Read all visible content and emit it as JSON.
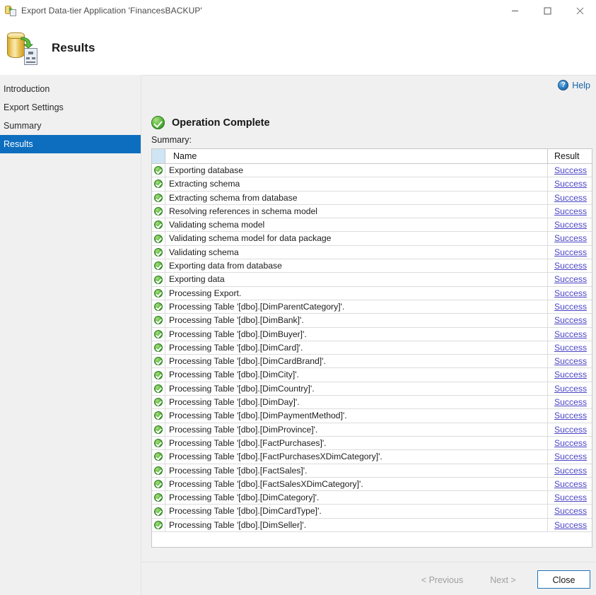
{
  "window": {
    "title": "Export Data-tier Application 'FinancesBACKUP'",
    "app_icon": "database-export-icon",
    "controls": {
      "minimize": "minimize-icon",
      "maximize": "maximize-icon",
      "close": "close-icon"
    }
  },
  "header": {
    "title": "Results",
    "icon": "database-to-document-icon"
  },
  "sidebar": {
    "items": [
      {
        "label": "Introduction",
        "active": false
      },
      {
        "label": "Export Settings",
        "active": false
      },
      {
        "label": "Summary",
        "active": false
      },
      {
        "label": "Results",
        "active": true
      }
    ]
  },
  "content": {
    "help_label": "Help",
    "help_icon": "help-circle-icon",
    "status_title": "Operation Complete",
    "status_icon": "success-check-icon",
    "summary_label": "Summary:"
  },
  "table": {
    "columns": {
      "icon": "",
      "name": "Name",
      "result": "Result"
    },
    "rows": [
      {
        "name": "Exporting database",
        "result": "Success"
      },
      {
        "name": "Extracting schema",
        "result": "Success"
      },
      {
        "name": "Extracting schema from database",
        "result": "Success"
      },
      {
        "name": "Resolving references in schema model",
        "result": "Success"
      },
      {
        "name": "Validating schema model",
        "result": "Success"
      },
      {
        "name": "Validating schema model for data package",
        "result": "Success"
      },
      {
        "name": "Validating schema",
        "result": "Success"
      },
      {
        "name": "Exporting data from database",
        "result": "Success"
      },
      {
        "name": "Exporting data",
        "result": "Success"
      },
      {
        "name": "Processing Export.",
        "result": "Success"
      },
      {
        "name": "Processing Table '[dbo].[DimParentCategory]'.",
        "result": "Success"
      },
      {
        "name": "Processing Table '[dbo].[DimBank]'.",
        "result": "Success"
      },
      {
        "name": "Processing Table '[dbo].[DimBuyer]'.",
        "result": "Success"
      },
      {
        "name": "Processing Table '[dbo].[DimCard]'.",
        "result": "Success"
      },
      {
        "name": "Processing Table '[dbo].[DimCardBrand]'.",
        "result": "Success"
      },
      {
        "name": "Processing Table '[dbo].[DimCity]'.",
        "result": "Success"
      },
      {
        "name": "Processing Table '[dbo].[DimCountry]'.",
        "result": "Success"
      },
      {
        "name": "Processing Table '[dbo].[DimDay]'.",
        "result": "Success"
      },
      {
        "name": "Processing Table '[dbo].[DimPaymentMethod]'.",
        "result": "Success"
      },
      {
        "name": "Processing Table '[dbo].[DimProvince]'.",
        "result": "Success"
      },
      {
        "name": "Processing Table '[dbo].[FactPurchases]'.",
        "result": "Success"
      },
      {
        "name": "Processing Table '[dbo].[FactPurchasesXDimCategory]'.",
        "result": "Success"
      },
      {
        "name": "Processing Table '[dbo].[FactSales]'.",
        "result": "Success"
      },
      {
        "name": "Processing Table '[dbo].[FactSalesXDimCategory]'.",
        "result": "Success"
      },
      {
        "name": "Processing Table '[dbo].[DimCategory]'.",
        "result": "Success"
      },
      {
        "name": "Processing Table '[dbo].[DimCardType]'.",
        "result": "Success"
      },
      {
        "name": "Processing Table '[dbo].[DimSeller]'.",
        "result": "Success"
      }
    ]
  },
  "footer": {
    "previous_label": "< Previous",
    "next_label": "Next >",
    "close_label": "Close",
    "previous_enabled": false,
    "next_enabled": false,
    "close_enabled": true
  },
  "colors": {
    "accent_blue": "#0d6ebf",
    "link_blue": "#4b45c6",
    "help_blue": "#1763a8",
    "success_green": "#56b43a",
    "header_tint": "#cfe5f5",
    "chrome_gray": "#f0f0f0"
  }
}
